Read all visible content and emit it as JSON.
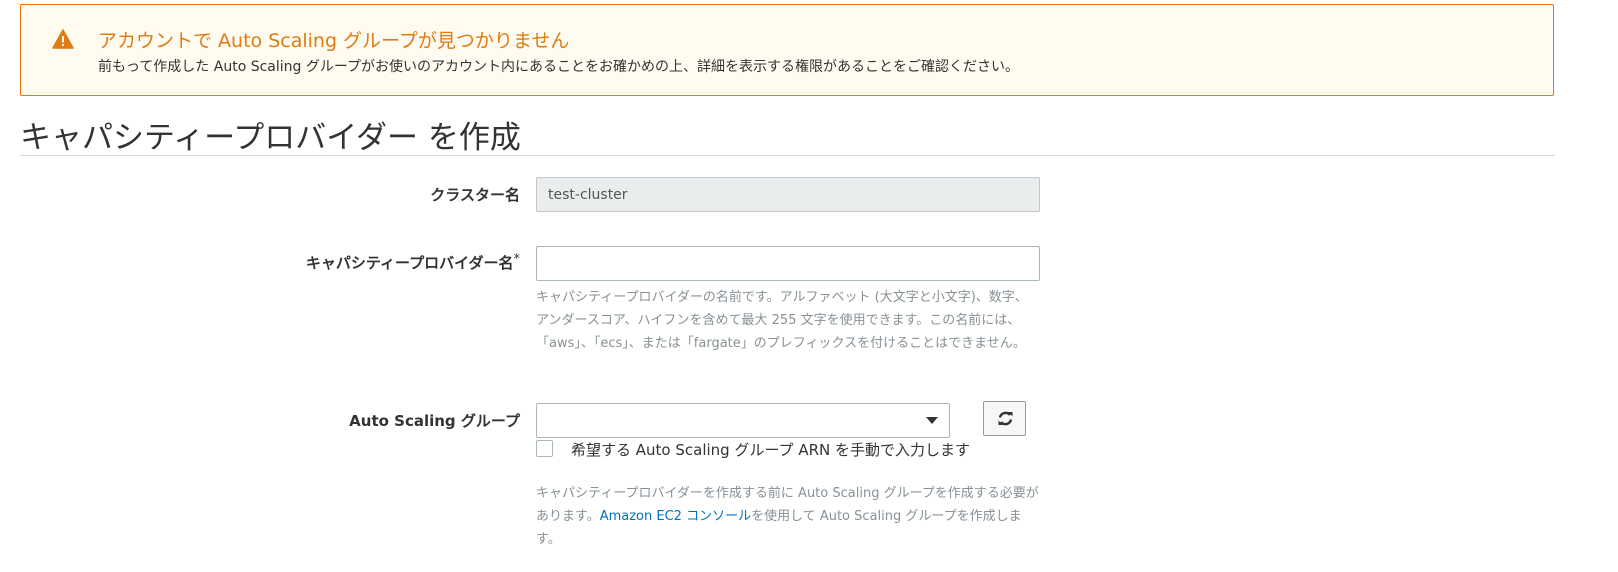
{
  "warning": {
    "title": "アカウントで Auto Scaling グループが見つかりません",
    "description": "前もって作成した Auto Scaling グループがお使いのアカウント内にあることをお確かめの上、詳細を表示する権限があることをご確認ください。",
    "icon": "warning-icon",
    "color": "#ec7211"
  },
  "page": {
    "title": "キャパシティープロバイダー を作成"
  },
  "form": {
    "cluster_name": {
      "label": "クラスター名",
      "value": "test-cluster"
    },
    "provider_name": {
      "label": "キャパシティープロバイダー名",
      "required_mark": "*",
      "value": "",
      "help_lines": [
        "キャパシティープロバイダーの名前です。アルファベット (大文字と小文字)、数字、",
        "アンダースコア、ハイフンを含めて最大 255 文字を使用できます。この名前には、",
        "「aws」、「ecs」、または「fargate」のプレフィックスを付けることはできません。"
      ]
    },
    "asg": {
      "label": "Auto Scaling グループ",
      "selected": "",
      "checkbox_label": "希望する Auto Scaling グループ ARN を手動で入力します",
      "checkbox_checked": false,
      "help_before_link": "キャパシティープロバイダーを作成する前に Auto Scaling グループを作成する必要があります。",
      "help_link": "Amazon EC2 コンソール",
      "help_after_link": "を使用して Auto Scaling グループを作成します。",
      "refresh_icon": "refresh-icon",
      "link_color": "#0073bb"
    }
  }
}
